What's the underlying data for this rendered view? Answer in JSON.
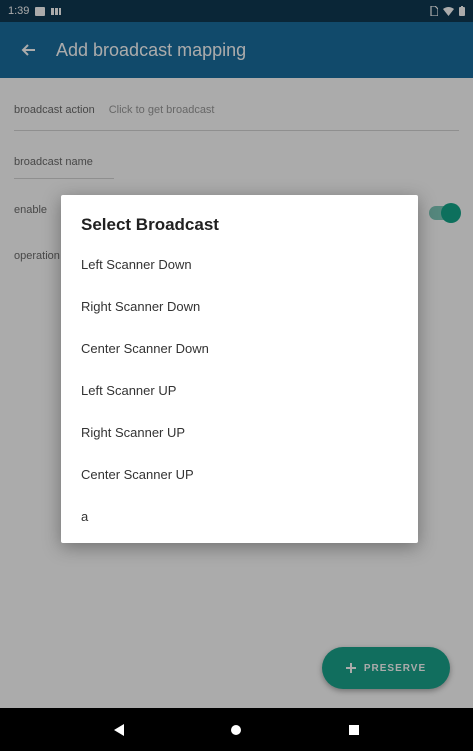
{
  "status_bar": {
    "time": "1:39",
    "icons": [
      "notification-icon",
      "battery-saver-icon",
      "sim-icon",
      "wifi-icon",
      "battery-icon"
    ]
  },
  "app_bar": {
    "title": "Add broadcast mapping",
    "back_icon": "arrow-back-icon"
  },
  "form": {
    "broadcast_action_label": "broadcast action",
    "broadcast_action_hint": "Click to get broadcast",
    "broadcast_name_label": "broadcast name",
    "enable_label": "enable",
    "operation_label": "operation",
    "enable_on": true
  },
  "dialog": {
    "title": "Select Broadcast",
    "items": [
      "Left Scanner Down",
      "Right Scanner Down",
      "Center Scanner Down",
      "Left Scanner UP",
      "Right Scanner UP",
      "Center Scanner UP",
      "a"
    ]
  },
  "fab": {
    "label": "PRESERVE",
    "icon": "plus-icon"
  },
  "nav_bar": {
    "icons": [
      "back-triangle-icon",
      "home-circle-icon",
      "recents-square-icon"
    ]
  },
  "colors": {
    "status_bar": "#0f3a53",
    "app_bar": "#1a6fa0",
    "accent": "#1aa58c"
  }
}
